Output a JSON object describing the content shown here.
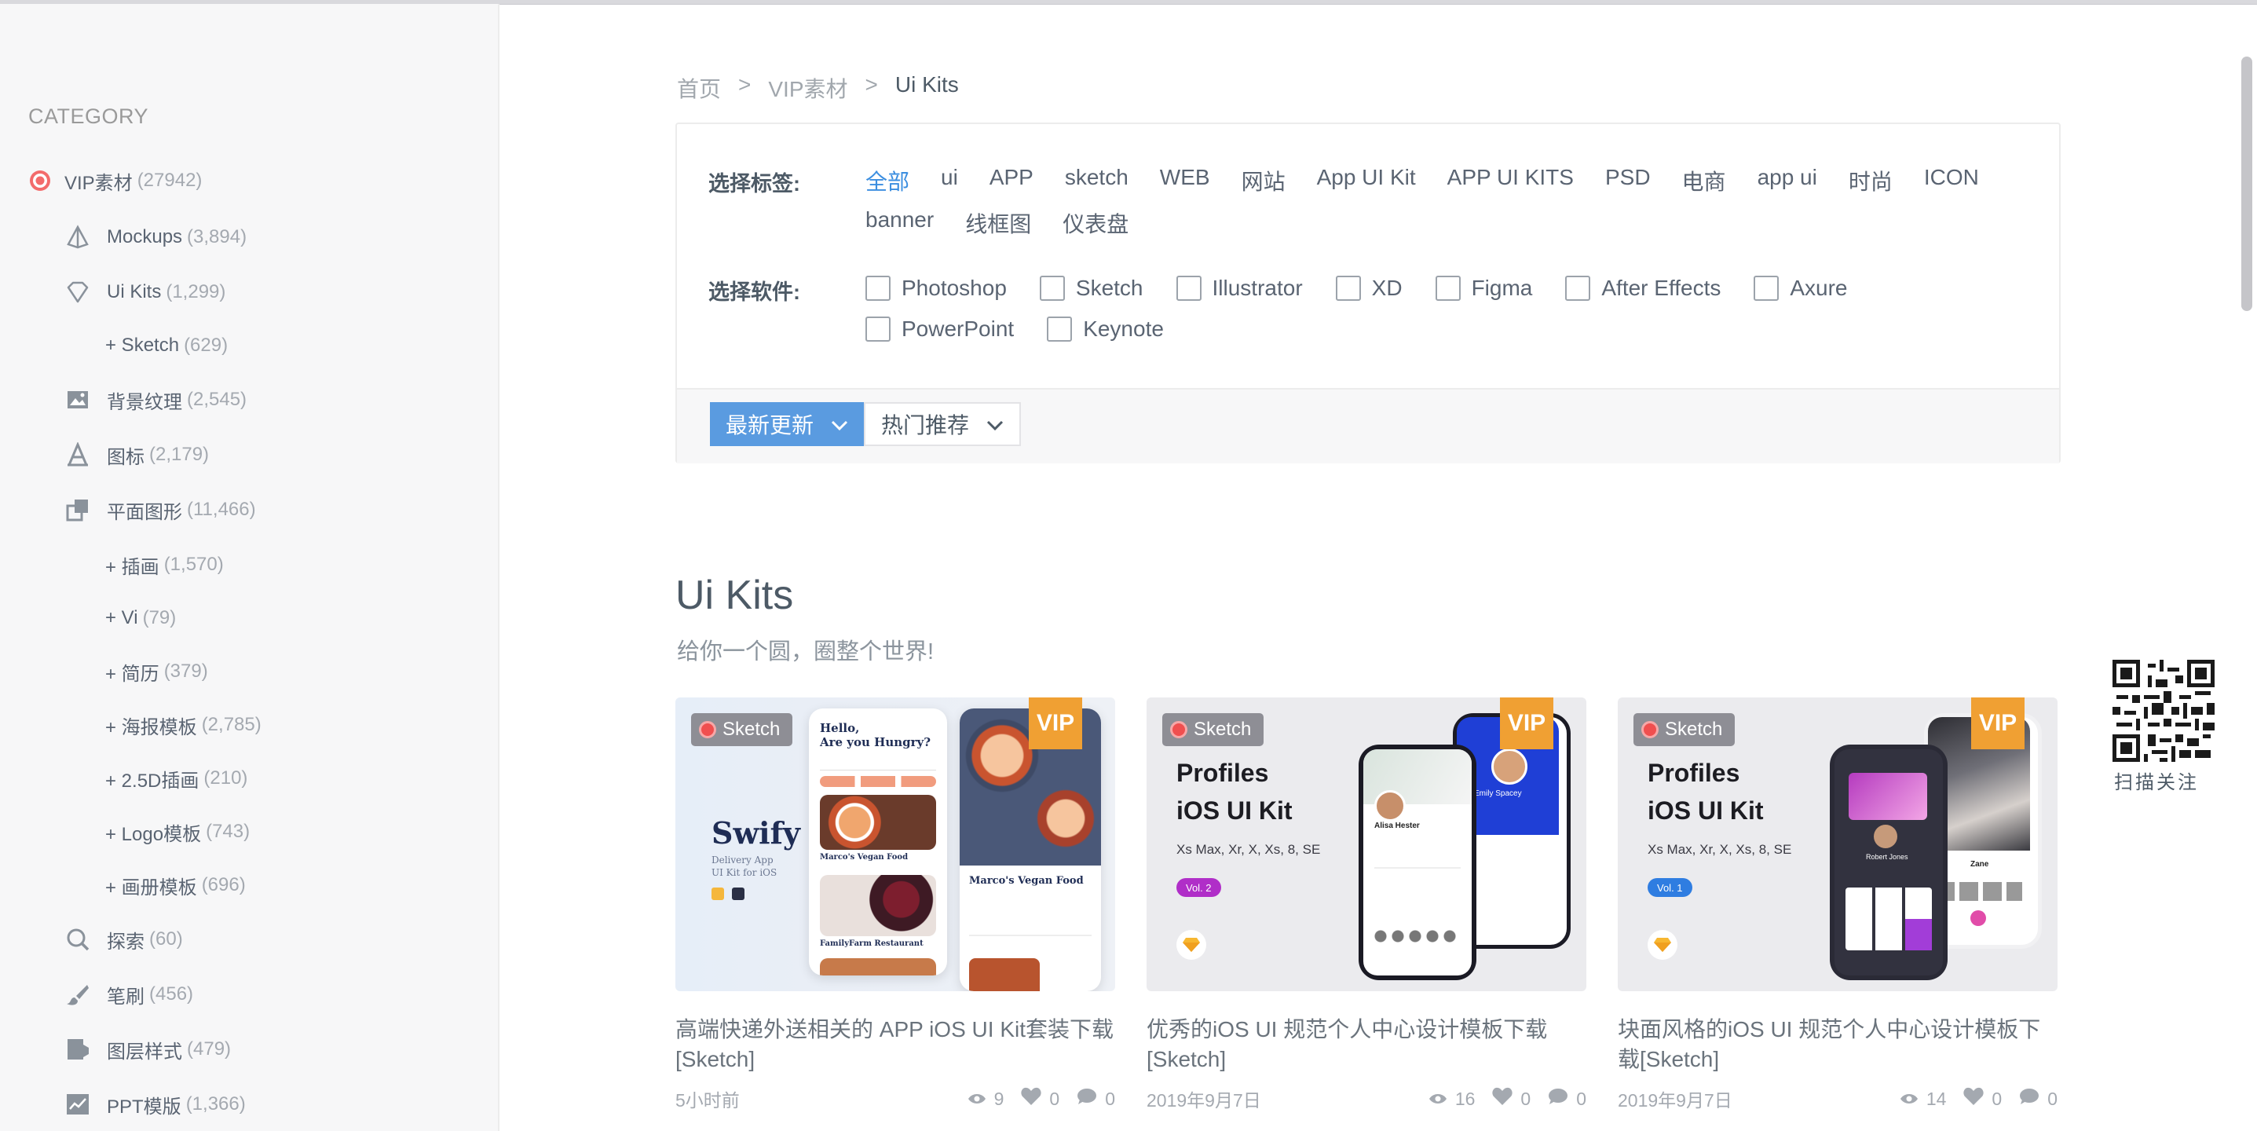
{
  "sidebar": {
    "title": "CATEGORY",
    "items": [
      {
        "label": "VIP素材",
        "count": "(27942)",
        "icon": "record-dot-icon"
      },
      {
        "label": "Mockups",
        "count": "(3,894)",
        "icon": "prism-icon"
      },
      {
        "label": "Ui Kits",
        "count": "(1,299)",
        "icon": "diamond-icon"
      },
      {
        "label": "+ Sketch",
        "count": "(629)"
      },
      {
        "label": "背景纹理",
        "count": "(2,545)",
        "icon": "image-icon"
      },
      {
        "label": "图标",
        "count": "(2,179)",
        "icon": "font-a-icon"
      },
      {
        "label": "平面图形",
        "count": "(11,466)",
        "icon": "overlap-squares-icon"
      },
      {
        "label": "+ 插画",
        "count": "(1,570)"
      },
      {
        "label": "+ Vi",
        "count": "(79)"
      },
      {
        "label": "+ 简历",
        "count": "(379)"
      },
      {
        "label": "+ 海报模板",
        "count": "(2,785)"
      },
      {
        "label": "+ 2.5D插画",
        "count": "(210)"
      },
      {
        "label": "+ Logo模板",
        "count": "(743)"
      },
      {
        "label": "+ 画册模板",
        "count": "(696)"
      },
      {
        "label": "探索",
        "count": "(60)",
        "icon": "search-icon"
      },
      {
        "label": "笔刷",
        "count": "(456)",
        "icon": "brush-icon"
      },
      {
        "label": "图层样式",
        "count": "(479)",
        "icon": "layer-style-icon"
      },
      {
        "label": "PPT模版",
        "count": "(1,366)",
        "icon": "chart-icon"
      }
    ]
  },
  "breadcrumb": [
    "首页",
    ">",
    "VIP素材",
    ">",
    "Ui Kits"
  ],
  "filter": {
    "tag_label": "选择标签:",
    "tags": [
      "全部",
      "ui",
      "APP",
      "sketch",
      "WEB",
      "网站",
      "App UI Kit",
      "APP UI KITS",
      "PSD",
      "电商",
      "app ui",
      "时尚",
      "ICON",
      "banner",
      "线框图",
      "仪表盘"
    ],
    "software_label": "选择软件:",
    "software": [
      "Photoshop",
      "Sketch",
      "Illustrator",
      "XD",
      "Figma",
      "After Effects",
      "Axure",
      "PowerPoint",
      "Keynote"
    ],
    "sort_latest": "最新更新",
    "sort_hot": "热门推荐"
  },
  "section": {
    "title": "Ui Kits",
    "subtitle": "给你一个圆，圈整个世界!"
  },
  "cards": [
    {
      "badge": "Sketch",
      "vip": "VIP",
      "preview": {
        "brand": "Swify",
        "line1": "Delivery App",
        "line2": "UI Kit for iOS",
        "hello": "Hello,",
        "hungry": "Are you Hungry?",
        "dish1": "Marco's Vegan Food",
        "dish2": "FamilyFarm Restaurant",
        "dish3": "Marco's Vegan Food"
      },
      "title": "高端快递外送相关的 APP iOS UI Kit套装下载[Sketch]",
      "time": "5小时前",
      "views": "9",
      "likes": "0",
      "comments": "0"
    },
    {
      "badge": "Sketch",
      "vip": "VIP",
      "preview": {
        "heading1": "Profiles",
        "heading2": "iOS UI Kit",
        "devices": "Xs Max, Xr, X, Xs, 8, SE",
        "vol": "Vol. 2",
        "person1": "Alisa Hester",
        "person2": "Emily Spacey"
      },
      "title": "优秀的iOS UI 规范个人中心设计模板下载[Sketch]",
      "time": "2019年9月7日",
      "views": "16",
      "likes": "0",
      "comments": "0"
    },
    {
      "badge": "Sketch",
      "vip": "VIP",
      "preview": {
        "heading1": "Profiles",
        "heading2": "iOS UI Kit",
        "devices": "Xs Max, Xr, X, Xs, 8, SE",
        "vol": "Vol. 1",
        "person1": "Robert Jones",
        "person2": "Zane"
      },
      "title": "块面风格的iOS UI 规范个人中心设计模板下载[Sketch]",
      "time": "2019年9月7日",
      "views": "14",
      "likes": "0",
      "comments": "0"
    }
  ],
  "qr": {
    "label": "扫描关注"
  },
  "colors": {
    "accent": "#3b8ee0",
    "vip": "#f0a033",
    "primary_button": "#5a9be0"
  }
}
